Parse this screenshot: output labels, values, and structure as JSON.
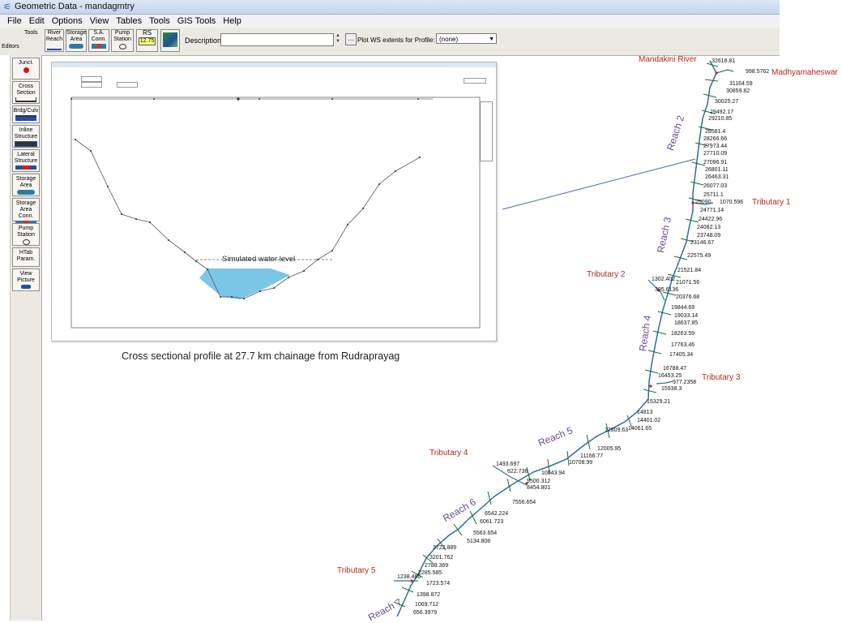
{
  "window": {
    "title": "Geometric Data - mandagmtry"
  },
  "menu": [
    "File",
    "Edit",
    "Options",
    "View",
    "Tables",
    "Tools",
    "GIS Tools",
    "Help"
  ],
  "toolbar": {
    "tools_label": "Tools",
    "editors_label": "Editors",
    "buttons": [
      "River Reach",
      "Storage Area",
      "S.A. Conn.",
      "Pump Station",
      "RS"
    ],
    "rs_value": "12.75",
    "description_label": "Description :",
    "description_value": "",
    "plot_ws_label": "Plot WS extents for Profile:",
    "profile_value": "(none)"
  },
  "sidebar": [
    "Junct.",
    "Cross Section",
    "Brdg/Culv",
    "Inline Structure",
    "Lateral Structure",
    "Storage Area",
    "Storage Area Conn.",
    "Pump Station",
    "HTab Param.",
    "View Picture"
  ],
  "inset": {
    "annotation": "Simulated water level",
    "caption": "Cross sectional profile at 27.7 km chainage from Rudraprayag"
  },
  "map": {
    "rivers": [
      {
        "label": "Mandakini River"
      },
      {
        "label": "Madhyamaheswar"
      }
    ],
    "tributaries": [
      "Tributary 1",
      "Tributary 2",
      "Tributary 3",
      "Tributary 4",
      "Tributary 5"
    ],
    "reaches": [
      "Reach 2",
      "Reach 3",
      "Reach 4",
      "Reach 5",
      "Reach 6",
      "Reach 7"
    ],
    "stations": [
      "32616.81",
      "998.5762",
      "31164.59",
      "30859.82",
      "30025.27",
      "29492.17",
      "29210.85",
      "28581.4",
      "28266.66",
      "27973.44",
      "27710.09",
      "27096.91",
      "26801.11",
      "26463.31",
      "26077.03",
      "25711.1",
      "25090",
      "1070.596",
      "24771.14",
      "24422.96",
      "24082.13",
      "23748.09",
      "23146.67",
      "22575.49",
      "21521.84",
      "1302.402",
      "21071.56",
      "395.6136",
      "20376.68",
      "19844.69",
      "19033.14",
      "18637.85",
      "18263.59",
      "17763.46",
      "17405.34",
      "16788.47",
      "16453.25",
      "977.2358",
      "15938.3",
      "15329.21",
      "14813",
      "14401.02",
      "14061.65",
      "12809.63",
      "12005.95",
      "11166.77",
      "10708.99",
      "10043.94",
      "1493.697",
      "622.736",
      "9500.312",
      "8454.801",
      "7556.654",
      "6542.224",
      "6061.723",
      "5563.654",
      "5134.808",
      "3722.889",
      "3201.762",
      "2788.369",
      "2285.585",
      "1238.466",
      "1723.574",
      "1398.872",
      "1069.712",
      "656.3979"
    ]
  }
}
